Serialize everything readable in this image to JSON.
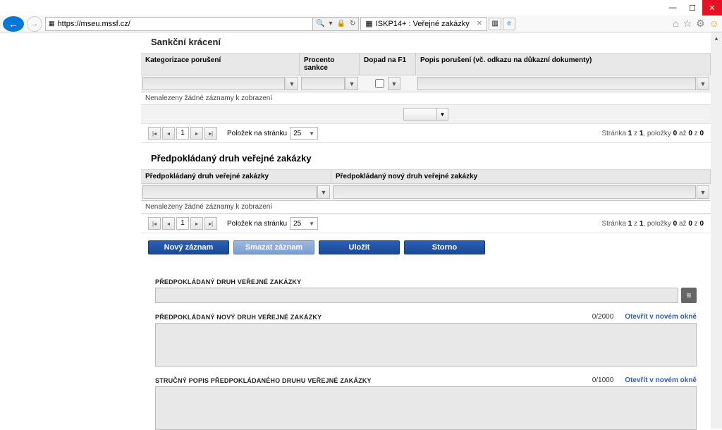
{
  "window": {
    "url": "https://mseu.mssf.cz/",
    "tab_title": "ISKP14+ : Veřejné zakázky"
  },
  "section1": {
    "title": "Sankční krácení",
    "cols": {
      "a": "Kategorizace porušení",
      "b": "Procento sankce",
      "c": "Dopad na F1",
      "d": "Popis porušení (vč. odkazu na důkazní dokumenty)"
    },
    "no_records": "Nenalezeny žádné záznamy k zobrazení"
  },
  "pager": {
    "page": "1",
    "items_label": "Položek na stránku",
    "items_value": "25",
    "info_prefix": "Stránka ",
    "info_pg": "1",
    "info_of": " z ",
    "info_total": "1",
    "info_items": ", položky ",
    "info_a": "0",
    "info_to": " až ",
    "info_b": "0",
    "info_of2": " z ",
    "info_c": "0"
  },
  "section2": {
    "title": "Předpokládaný druh veřejné zakázky",
    "col_a": "Předpokládaný druh veřejné zakázky",
    "col_b": "Předpokládaný nový druh veřejné zakázky",
    "no_records": "Nenalezeny žádné záznamy k zobrazení"
  },
  "buttons": {
    "new": "Nový záznam",
    "delete": "Smazat záznam",
    "save": "Uložit",
    "cancel": "Storno"
  },
  "form": {
    "f1_label": "PŘEDPOKLÁDANÝ DRUH VEŘEJNÉ ZAKÁZKY",
    "f2_label": "PŘEDPOKLÁDANÝ NOVÝ DRUH VEŘEJNÉ ZAKÁZKY",
    "f2_counter": "0/2000",
    "f3_label": "STRUČNÝ POPIS PŘEDPOKLÁDANÉHO DRUHU VEŘEJNÉ ZAKÁZKY",
    "f3_counter": "0/1000",
    "open_link": "Otevřít v novém okně"
  }
}
